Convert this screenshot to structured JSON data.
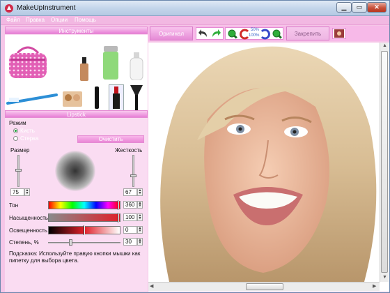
{
  "window": {
    "title": "MakeUpInstrument"
  },
  "menu": [
    "Файл",
    "Правка",
    "Опции",
    "Помощь"
  ],
  "tools_panel": {
    "header": "Инструменты",
    "tools": [
      "cosmetic-bag",
      "foundation",
      "powder-tube",
      "lotion-bottle",
      "toothbrush",
      "eyeshadow-palette",
      "mascara",
      "lipstick",
      "powder-brush"
    ],
    "selected_tool": "lipstick"
  },
  "lipstick_panel": {
    "header": "Lipstick",
    "mode_label": "Режим",
    "mode_options": [
      "Кисть",
      "Стерка"
    ],
    "mode_selected": "Кисть",
    "clear_button": "Очистить",
    "size_label": "Размер",
    "hardness_label": "Жесткость",
    "size_value": "75",
    "hardness_value": "67",
    "tone_label": "Тон",
    "tone_value": "360",
    "saturation_label": "Насыщенность",
    "saturation_value": "100",
    "lightness_label": "Освещенность",
    "lightness_value": "0",
    "degree_label": "Степень, %",
    "degree_value": "30",
    "hint": "Подсказка: Используйте правую кнопки мышки как пипетку для выбора цвета."
  },
  "toolbar": {
    "original_button": "Оригинал",
    "apply_button": "Закрепить",
    "zoom_label_top": "50%",
    "zoom_label_bottom": "100%"
  },
  "colors": {
    "accent_pink": "#e986d6",
    "panel_pink": "#fadcf2",
    "title_blue": "#c2d4ea"
  }
}
